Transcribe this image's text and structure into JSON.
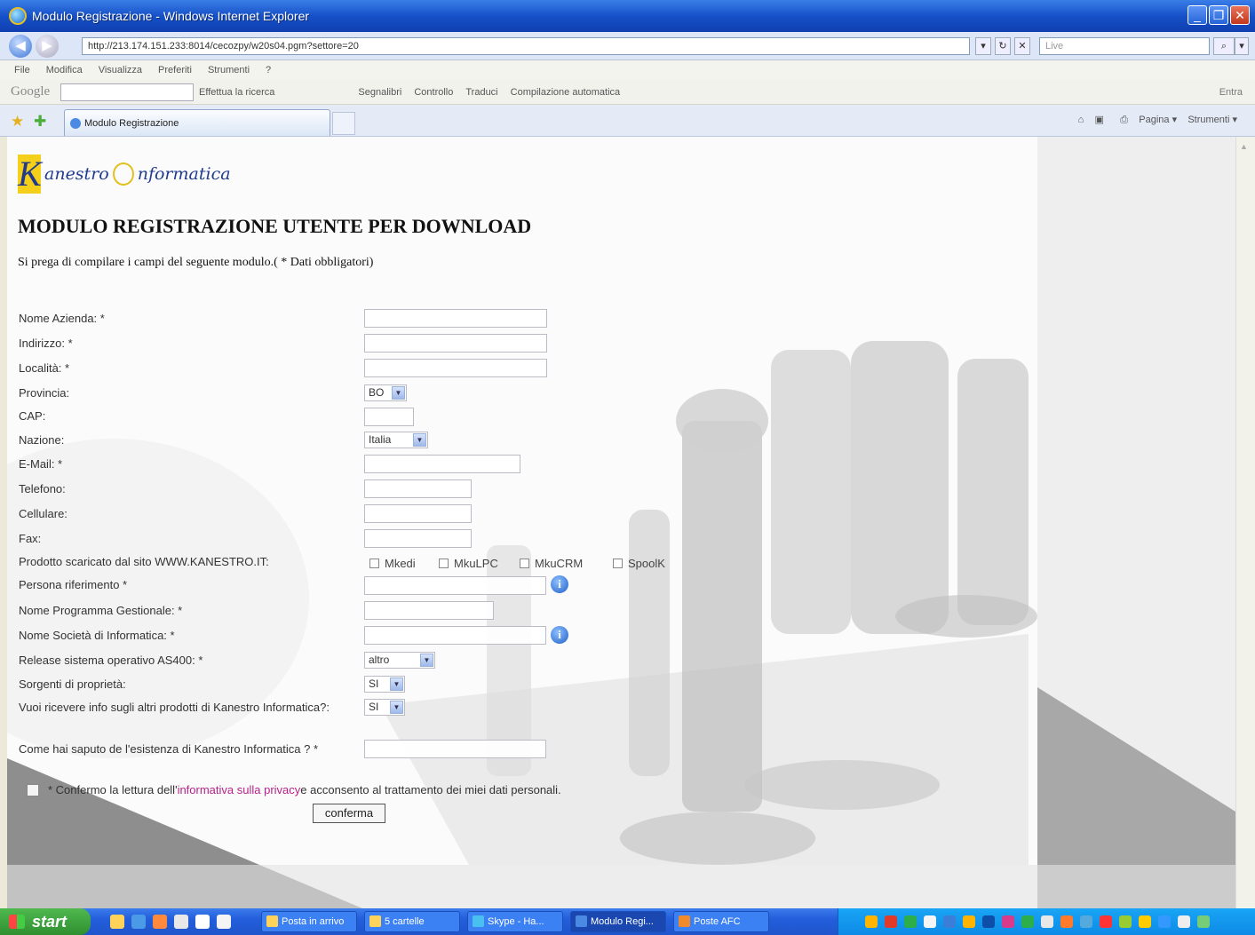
{
  "window": {
    "title": "Modulo Registrazione - Windows Internet Explorer"
  },
  "browser": {
    "url": "http://213.174.151.233:8014/cecozpy/w20s04.pgm?settore=20",
    "search_placeholder": "Live",
    "menu": [
      "File",
      "Modifica",
      "Visualizza",
      "Preferiti",
      "Strumenti",
      "?"
    ],
    "google_label": "Google",
    "google_items": [
      "Effettua la ricerca",
      "Segnalibri",
      "Controllo",
      "Traduci",
      "Compilazione automatica"
    ],
    "google_right": "Entra",
    "tab_title": "Modulo Registrazione",
    "command_items": [
      "Pagina",
      "Strumenti"
    ]
  },
  "page": {
    "logo_text_1": "anestro",
    "logo_text_2": "nformatica",
    "logo_letter": "K",
    "heading": "MODULO REGISTRAZIONE UTENTE PER DOWNLOAD",
    "intro": "Si prega di compilare i campi del seguente modulo.( * Dati obbligatori)"
  },
  "form": {
    "labels": {
      "nome_azienda": "Nome Azienda: *",
      "indirizzo": "Indirizzo: *",
      "localita": "Località: *",
      "provincia": "Provincia:",
      "cap": "CAP:",
      "nazione": "Nazione:",
      "email": "E-Mail: *",
      "telefono": "Telefono:",
      "cellulare": "Cellulare:",
      "fax": "Fax:",
      "prodotto": "Prodotto scaricato dal sito WWW.KANESTRO.IT:",
      "persona": "Persona riferimento *",
      "programma": "Nome Programma Gestionale: *",
      "societa": "Nome Società di Informatica: *",
      "release": "Release sistema operativo AS400: *",
      "sorgenti": "Sorgenti di proprietà:",
      "info": "Vuoi ricevere info sugli altri prodotti di Kanestro Informatica?:",
      "come": "Come hai saputo de l'esistenza di Kanestro Informatica ? *"
    },
    "values": {
      "provincia": "BO",
      "nazione": "Italia",
      "release": "altro",
      "sorgenti": "SI",
      "info": "SI"
    },
    "products": [
      "Mkedi",
      "MkuLPC",
      "MkuCRM",
      "SpoolK"
    ],
    "consent_prefix": "* Confermo la lettura dell'",
    "consent_link": "informativa sulla privacy",
    "consent_suffix": " e acconsento al trattamento dei miei dati personali.",
    "submit": "conferma"
  },
  "taskbar": {
    "start": "start",
    "tasks": [
      "Posta in arrivo",
      "5 cartelle",
      "Skype - Ha...",
      "Modulo Regi...",
      "Poste AFC"
    ]
  },
  "colors": {
    "titlebar": "#1650c8",
    "taskbar": "#245edb",
    "start": "#2f8f2f",
    "link": "#b5238a",
    "logo_yellow": "#f4d01a"
  }
}
